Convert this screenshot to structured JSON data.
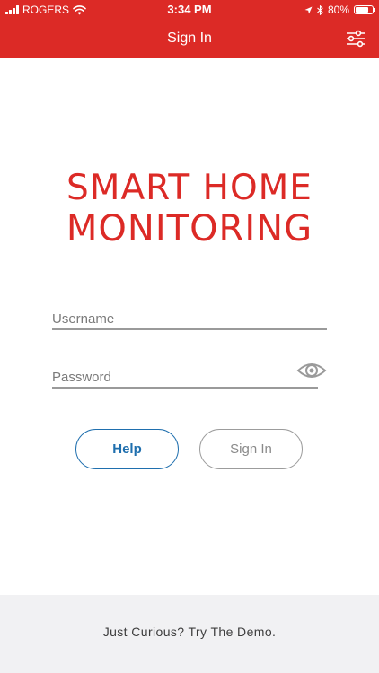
{
  "status_bar": {
    "carrier": "ROGERS",
    "time": "3:34 PM",
    "battery": "80%",
    "battery_level": 0.8
  },
  "header": {
    "title": "Sign In",
    "settings_icon": "sliders-icon"
  },
  "logo": {
    "line1": "SMART HOME",
    "line2": "MONITORING"
  },
  "form": {
    "username_placeholder": "Username",
    "username_value": "",
    "password_placeholder": "Password",
    "password_value": "",
    "reveal_icon": "eye-icon"
  },
  "buttons": {
    "help_label": "Help",
    "signin_label": "Sign In"
  },
  "footer": {
    "demo_label": "Just Curious? Try The Demo."
  },
  "colors": {
    "brand_red": "#dc2a26",
    "help_blue": "#1f6fae",
    "footer_bg": "#f1f1f3"
  }
}
